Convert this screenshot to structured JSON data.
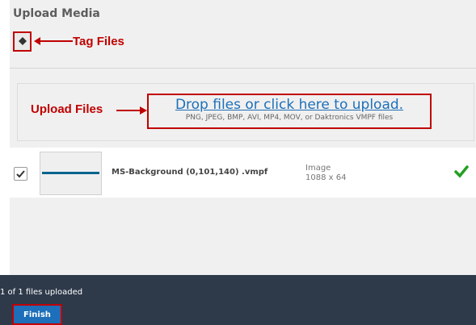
{
  "header": {
    "title": "Upload Media"
  },
  "callouts": {
    "tag_files": "Tag Files",
    "upload_files": "Upload Files"
  },
  "dropzone": {
    "link_text": "Drop files or click here to upload.",
    "hint": "PNG, JPEG, BMP, AVI, MP4, MOV, or Daktronics VMPF files"
  },
  "files": [
    {
      "name": "MS-Background (0,101,140) .vmpf",
      "type": "Image",
      "dimensions": "1088 x 64",
      "checked": true,
      "status": "uploaded"
    }
  ],
  "footer": {
    "status": "1 of 1 files uploaded",
    "finish_label": "Finish"
  },
  "colors": {
    "accent": "#1c6fb8",
    "annotation": "#c00000",
    "success": "#22a022",
    "footer_bg": "#2e3a4a"
  },
  "icons": {
    "tag": "tag-icon",
    "checkbox": "checkmark-icon",
    "status": "success-check-icon"
  }
}
